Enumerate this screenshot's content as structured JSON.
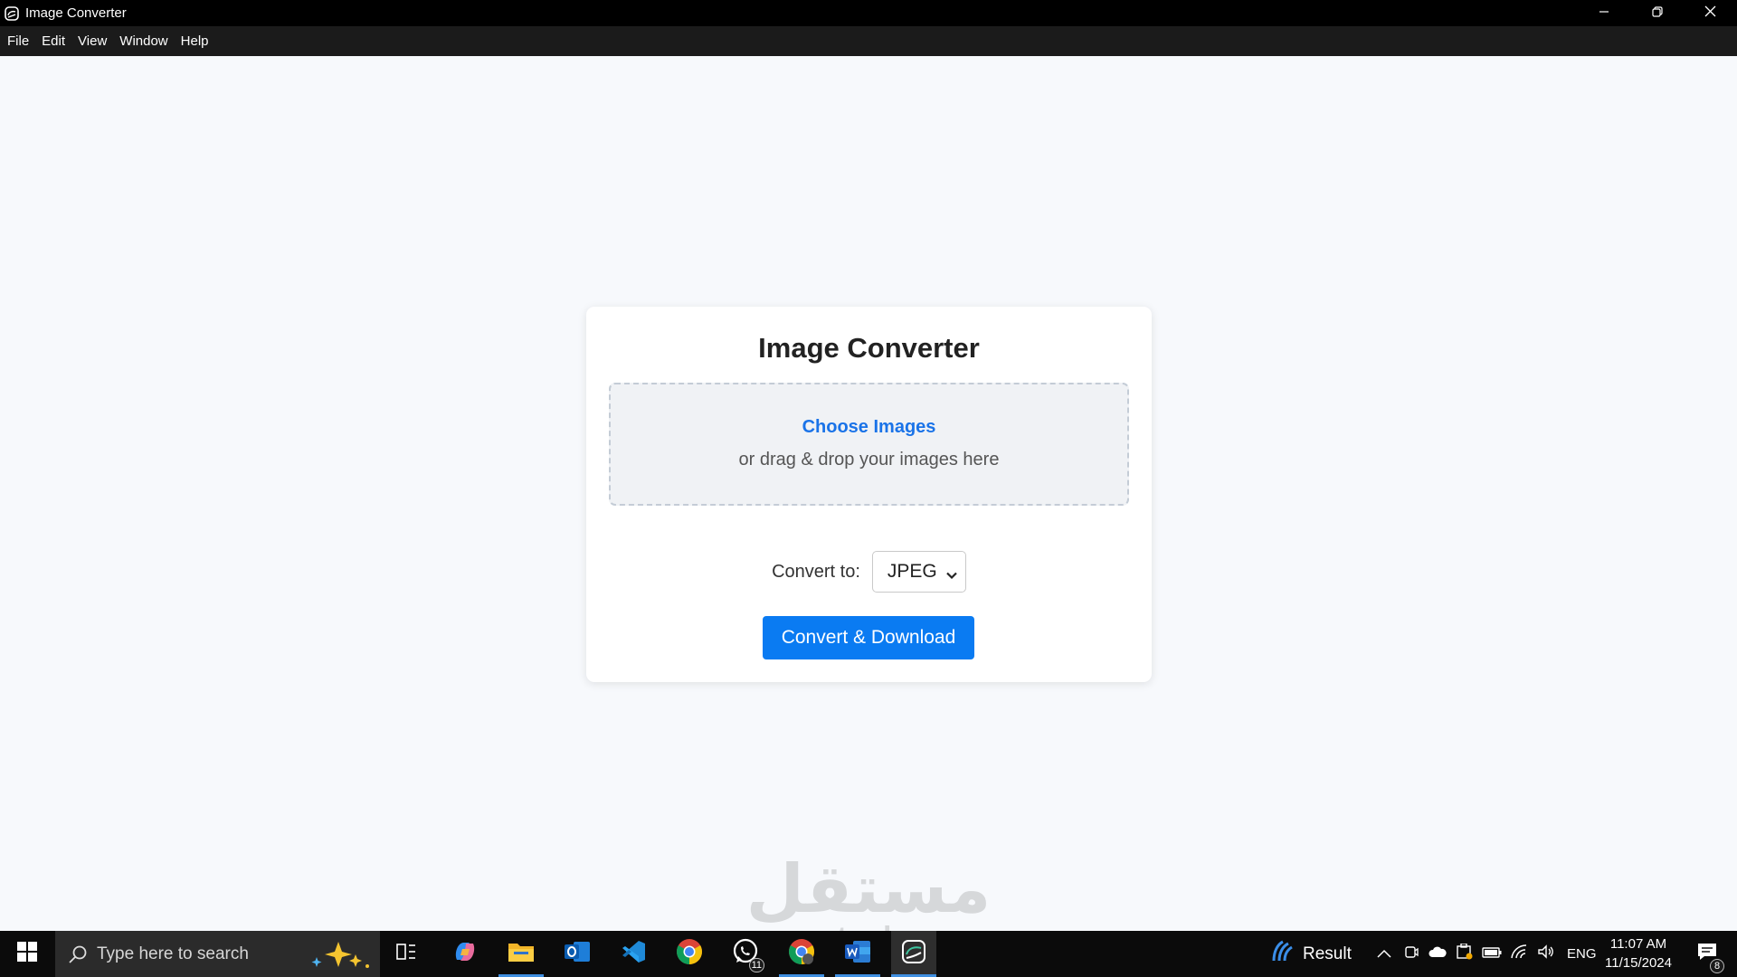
{
  "window": {
    "title": "Image Converter",
    "minimize_icon": "minimize-icon",
    "restore_icon": "restore-icon",
    "close_icon": "close-icon"
  },
  "menu": [
    {
      "label": "File"
    },
    {
      "label": "Edit"
    },
    {
      "label": "View"
    },
    {
      "label": "Window"
    },
    {
      "label": "Help"
    }
  ],
  "card": {
    "title": "Image Converter",
    "choose_label": "Choose Images",
    "drop_hint": "or drag & drop your images here",
    "convert_label": "Convert to:",
    "format_selected": "JPEG",
    "button_label": "Convert & Download"
  },
  "watermark": {
    "arabic": "مستقل",
    "latin": "mostaql.com"
  },
  "taskbar": {
    "search_placeholder": "Type here to search",
    "whatsapp_badge": "11",
    "notification_badge": "8",
    "widget_label": "Result",
    "language": "ENG",
    "time": "11:07 AM",
    "date": "11/15/2024"
  },
  "colors": {
    "accent": "#0a7bf2",
    "link": "#1a73e8",
    "page_bg": "#f7f9fc"
  }
}
